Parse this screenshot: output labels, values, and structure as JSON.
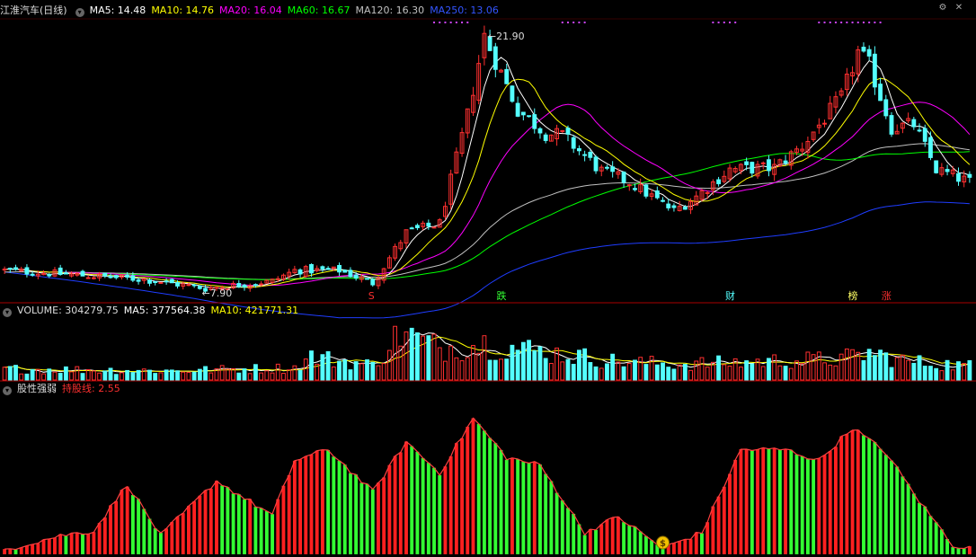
{
  "colors": {
    "up": "#ff3030",
    "down": "#54ffff",
    "ma5": "#ffffff",
    "ma10": "#ffff00",
    "ma20": "#ff00ff",
    "ma60": "#00ff00",
    "ma120": "#c0c0c0",
    "ma250": "#1f3dff",
    "osc_up": "#ff2020",
    "osc_down": "#33ff33",
    "separator": "#aa0000"
  },
  "window_icons": [
    "gear-icon",
    "close-icon"
  ],
  "price_panel": {
    "stock_name": "江淮汽车(日线)",
    "ma5": "MA5: 14.48",
    "ma10": "MA10: 14.76",
    "ma20": "MA20: 16.04",
    "ma60": "MA60: 16.67",
    "ma120": "MA120: 16.30",
    "ma250": "MA250: 13.06",
    "high_label": "21.90",
    "low_label": "7.90",
    "events": [
      {
        "label": "S",
        "color": "#ff3030",
        "index": 66
      },
      {
        "label": "跌",
        "color": "#33ff33",
        "index": 89
      },
      {
        "label": "财",
        "color": "#54ffff",
        "index": 130
      },
      {
        "label": "榜",
        "color": "#ffff66",
        "index": 152
      },
      {
        "label": "涨",
        "color": "#ff3030",
        "index": 158
      }
    ]
  },
  "volume_panel": {
    "label": "VOLUME: 304279.75",
    "ma5": "MA5: 377564.38",
    "ma10": "MA10: 421771.31"
  },
  "strength_panel": {
    "title": "股性强弱",
    "line_label": "持股线: 2.55"
  },
  "chart_data": [
    {
      "type": "candlestick",
      "title": "江淮汽车(日线)",
      "x_count": 174,
      "ylim": [
        7.2,
        22.8
      ],
      "anchors": [
        [
          0,
          8.9
        ],
        [
          25,
          8.4
        ],
        [
          36,
          7.9
        ],
        [
          48,
          8.3
        ],
        [
          52,
          8.9
        ],
        [
          60,
          8.9
        ],
        [
          66,
          8.2
        ],
        [
          72,
          11.0
        ],
        [
          78,
          11.5
        ],
        [
          83,
          17.5
        ],
        [
          86,
          21.9
        ],
        [
          92,
          17.8
        ],
        [
          97,
          16.5
        ],
        [
          100,
          16.4
        ],
        [
          107,
          14.4
        ],
        [
          112,
          13.8
        ],
        [
          120,
          12.2
        ],
        [
          124,
          13.0
        ],
        [
          130,
          14.5
        ],
        [
          138,
          14.6
        ],
        [
          143,
          15.8
        ],
        [
          150,
          18.5
        ],
        [
          153,
          21.0
        ],
        [
          155,
          20.3
        ],
        [
          159,
          16.8
        ],
        [
          163,
          17.0
        ],
        [
          167,
          14.5
        ],
        [
          173,
          13.8
        ]
      ],
      "high": 21.9,
      "low": 7.9,
      "ma_legend": [
        "MA5: 14.48",
        "MA10: 14.76",
        "MA20: 16.04",
        "MA60: 16.67",
        "MA120: 16.30",
        "MA250: 13.06"
      ]
    },
    {
      "type": "bar",
      "title": "VOLUME",
      "last": 304279.75,
      "ma5": 377564.38,
      "ma10": 421771.31,
      "ylim": [
        0,
        1000000
      ],
      "anchors": [
        [
          0,
          180000
        ],
        [
          30,
          150000
        ],
        [
          52,
          200000
        ],
        [
          55,
          380000
        ],
        [
          66,
          240000
        ],
        [
          71,
          780000
        ],
        [
          78,
          520000
        ],
        [
          86,
          600000
        ],
        [
          95,
          480000
        ],
        [
          110,
          300000
        ],
        [
          120,
          260000
        ],
        [
          130,
          280000
        ],
        [
          140,
          320000
        ],
        [
          150,
          340000
        ],
        [
          155,
          440000
        ],
        [
          162,
          300000
        ],
        [
          173,
          230000
        ]
      ]
    },
    {
      "type": "bar",
      "title": "股性强弱",
      "line_label": "持股线: 2.55",
      "ylim": [
        0,
        10
      ],
      "anchors": [
        [
          0,
          0.3
        ],
        [
          10,
          1.2
        ],
        [
          16,
          1.5
        ],
        [
          22,
          4.5
        ],
        [
          28,
          1.2
        ],
        [
          38,
          4.7
        ],
        [
          48,
          2.5
        ],
        [
          52,
          6.0
        ],
        [
          58,
          6.7
        ],
        [
          66,
          4.0
        ],
        [
          72,
          7.2
        ],
        [
          78,
          5.2
        ],
        [
          84,
          8.7
        ],
        [
          90,
          6.2
        ],
        [
          96,
          5.7
        ],
        [
          104,
          1.4
        ],
        [
          110,
          2.4
        ],
        [
          118,
          0.4
        ],
        [
          125,
          1.4
        ],
        [
          132,
          6.7
        ],
        [
          140,
          6.7
        ],
        [
          146,
          6.0
        ],
        [
          152,
          8.1
        ],
        [
          158,
          6.5
        ],
        [
          164,
          3.4
        ],
        [
          170,
          0.6
        ],
        [
          173,
          0.4
        ]
      ]
    }
  ]
}
